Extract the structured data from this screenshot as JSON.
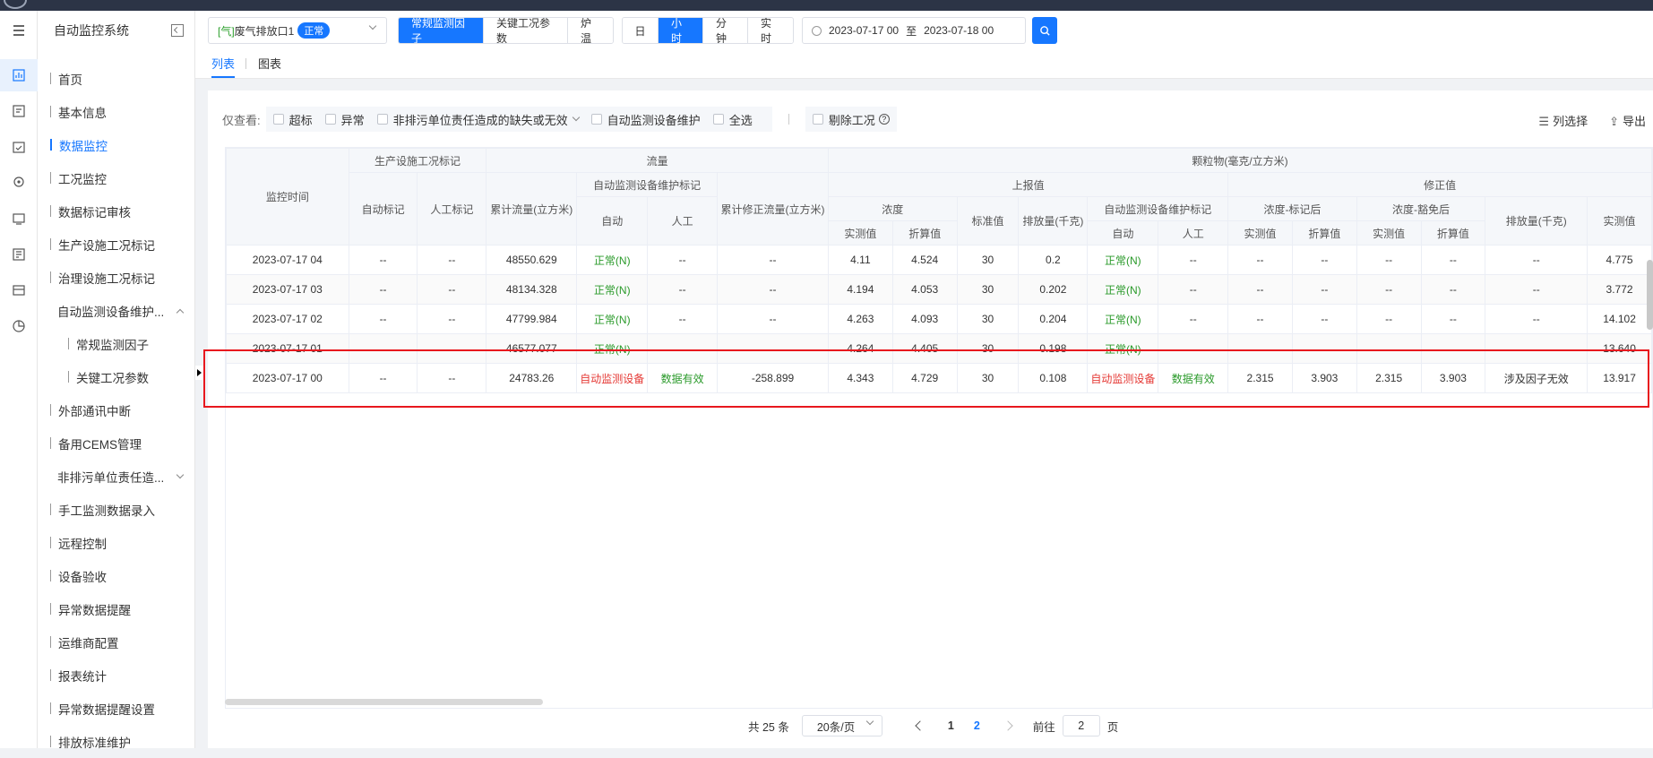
{
  "sidebar": {
    "title": "自动监控系统",
    "items": [
      {
        "label": "首页"
      },
      {
        "label": "基本信息"
      },
      {
        "label": "数据监控"
      },
      {
        "label": "工况监控"
      },
      {
        "label": "数据标记审核"
      },
      {
        "label": "生产设施工况标记"
      },
      {
        "label": "治理设施工况标记"
      },
      {
        "label": "自动监测设备维护..."
      },
      {
        "label": "常规监测因子"
      },
      {
        "label": "关键工况参数"
      },
      {
        "label": "外部通讯中断"
      },
      {
        "label": "备用CEMS管理"
      },
      {
        "label": "非排污单位责任造..."
      },
      {
        "label": "手工监测数据录入"
      },
      {
        "label": "远程控制"
      },
      {
        "label": "设备验收"
      },
      {
        "label": "异常数据提醒"
      },
      {
        "label": "运维商配置"
      },
      {
        "label": "报表统计"
      },
      {
        "label": "异常数据提醒设置"
      },
      {
        "label": "排放标准维护"
      }
    ]
  },
  "toolbar": {
    "outlet_prefix": "[气]",
    "outlet_name": "废气排放口1",
    "outlet_status": "正常",
    "factor_tabs": [
      "常规监测因子",
      "关键工况参数",
      "炉温"
    ],
    "time_tabs": [
      "日",
      "小时",
      "分钟",
      "实时"
    ],
    "date_start": "2023-07-17 00",
    "date_sep": "至",
    "date_end": "2023-07-18 00"
  },
  "view_tabs": [
    "列表",
    "图表"
  ],
  "filters": {
    "label": "仅查看:",
    "options": [
      "超标",
      "异常",
      "非排污单位责任造成的缺失或无效",
      "自动监测设备维护",
      "全选"
    ],
    "exclude_label": "剔除工况",
    "help_glyph": "?"
  },
  "tools": {
    "columns": "列选择",
    "export": "导出",
    "columns_icon": "☰",
    "export_icon": "⇪"
  },
  "table": {
    "h1": [
      "监控时间",
      "生产设施工况标记",
      "流量",
      "颗粒物(毫克/立方米)"
    ],
    "h2": [
      "自动标记",
      "人工标记",
      "累计流量(立方米)",
      "自动监测设备维护标记",
      "累计修正流量(立方米)",
      "上报值",
      "修正值"
    ],
    "h3": [
      "自动",
      "人工",
      "浓度",
      "标准值",
      "排放量(千克)",
      "自动监测设备维护标记",
      "浓度-标记后",
      "浓度-豁免后",
      "排放量(千克)"
    ],
    "h4": [
      "实测值",
      "折算值",
      "自动",
      "人工",
      "实测值",
      "折算值",
      "实测值",
      "折算值",
      "实测值"
    ],
    "rows": [
      [
        "2023-07-17 04",
        "--",
        "--",
        "48550.629",
        "正常(N)",
        "--",
        "--",
        "4.11",
        "4.524",
        "30",
        "0.2",
        "正常(N)",
        "--",
        "--",
        "--",
        "--",
        "--",
        "--",
        "4.775"
      ],
      [
        "2023-07-17 03",
        "--",
        "--",
        "48134.328",
        "正常(N)",
        "--",
        "--",
        "4.194",
        "4.053",
        "30",
        "0.202",
        "正常(N)",
        "--",
        "--",
        "--",
        "--",
        "--",
        "--",
        "3.772"
      ],
      [
        "2023-07-17 02",
        "--",
        "--",
        "47799.984",
        "正常(N)",
        "--",
        "--",
        "4.263",
        "4.093",
        "30",
        "0.204",
        "正常(N)",
        "--",
        "--",
        "--",
        "--",
        "--",
        "--",
        "14.102"
      ],
      [
        "2023-07-17 01",
        "",
        "",
        "46577.077",
        "正常(N)",
        "",
        "",
        "4.264",
        "4.405",
        "30",
        "0.198",
        "正常(N)",
        "",
        "",
        "",
        "",
        "",
        "",
        "13.640"
      ],
      [
        "2023-07-17 00",
        "--",
        "--",
        "24783.26",
        "自动监测设备",
        "数据有效",
        "-258.899",
        "4.343",
        "4.729",
        "30",
        "0.108",
        "自动监测设备",
        "数据有效",
        "2.315",
        "3.903",
        "2.315",
        "3.903",
        "涉及因子无效",
        "13.917"
      ]
    ]
  },
  "pager": {
    "total": "共 25 条",
    "page_size": "20条/页",
    "pages": [
      "1",
      "2"
    ],
    "goto_label": "前往",
    "goto_value": "2",
    "page_suffix": "页"
  },
  "colors": {
    "accent": "#1677ff",
    "ok": "#2a9a2a",
    "warn": "#e53935",
    "highlight": "#e8181e"
  }
}
